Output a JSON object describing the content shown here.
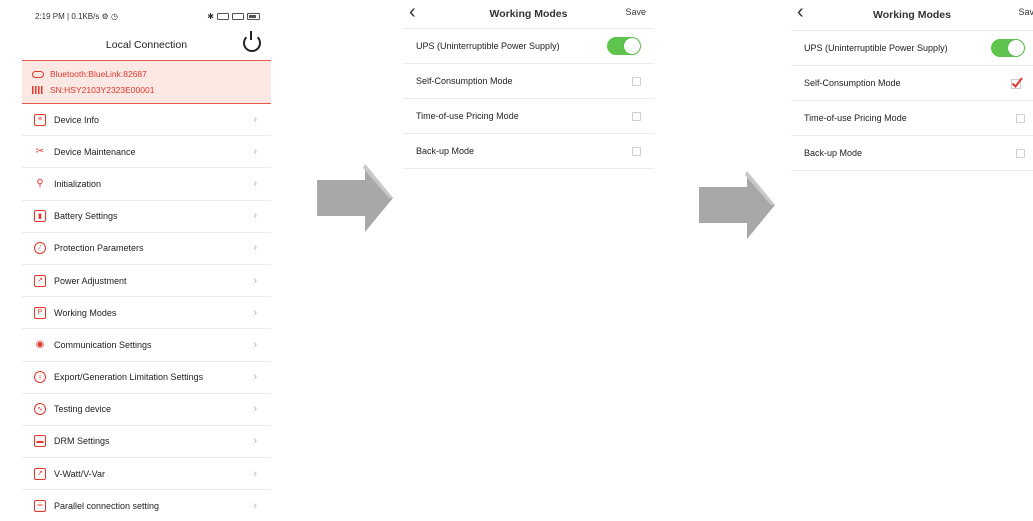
{
  "status_bar": {
    "text": "2:19 PM | 0.1KB/s ⚙ ◷",
    "battery_icon": "battery-icon",
    "signal_icon": "signal-icon"
  },
  "local_connection": {
    "title": "Local Connection",
    "bluetooth": "Bluetooth:BlueLink:82687",
    "serial": "SN:HSY2103Y2323E00001",
    "menu": [
      {
        "label": "Device Info",
        "icon": "device-info-icon"
      },
      {
        "label": "Device Maintenance",
        "icon": "tools-icon"
      },
      {
        "label": "Initialization",
        "icon": "person-icon"
      },
      {
        "label": "Battery Settings",
        "icon": "battery-icon"
      },
      {
        "label": "Protection Parameters",
        "icon": "forbidden-icon"
      },
      {
        "label": "Power Adjustment",
        "icon": "chart-icon"
      },
      {
        "label": "Working Modes",
        "icon": "mode-icon"
      },
      {
        "label": "Communication Settings",
        "icon": "antenna-icon"
      },
      {
        "label": "Export/Generation Limitation Settings",
        "icon": "info-icon"
      },
      {
        "label": "Testing device",
        "icon": "test-icon"
      },
      {
        "label": "DRM Settings",
        "icon": "drm-icon"
      },
      {
        "label": "V-Watt/V-Var",
        "icon": "graph-icon"
      },
      {
        "label": "Parallel connection setting",
        "icon": "parallel-icon"
      }
    ]
  },
  "working_modes_before": {
    "title": "Working Modes",
    "save": "Save",
    "rows": [
      {
        "label": "UPS (Uninterruptible Power Supply)",
        "control": "toggle",
        "on": true
      },
      {
        "label": "Self-Consumption Mode",
        "control": "checkbox",
        "checked": false
      },
      {
        "label": "Time-of-use Pricing Mode",
        "control": "checkbox",
        "checked": false
      },
      {
        "label": "Back-up Mode",
        "control": "checkbox",
        "checked": false
      }
    ]
  },
  "working_modes_after": {
    "title": "Working Modes",
    "save": "Save",
    "rows": [
      {
        "label": "UPS (Uninterruptible Power Supply)",
        "control": "toggle",
        "on": true
      },
      {
        "label": "Self-Consumption Mode",
        "control": "checkbox",
        "checked": true
      },
      {
        "label": "Time-of-use Pricing Mode",
        "control": "checkbox",
        "checked": false
      },
      {
        "label": "Back-up Mode",
        "control": "checkbox",
        "checked": false
      }
    ]
  },
  "colors": {
    "accent": "#e0372f",
    "toggle_on": "#5ec44e",
    "arrow": "#a8a8a8",
    "bt_bg": "#fde8e3"
  }
}
